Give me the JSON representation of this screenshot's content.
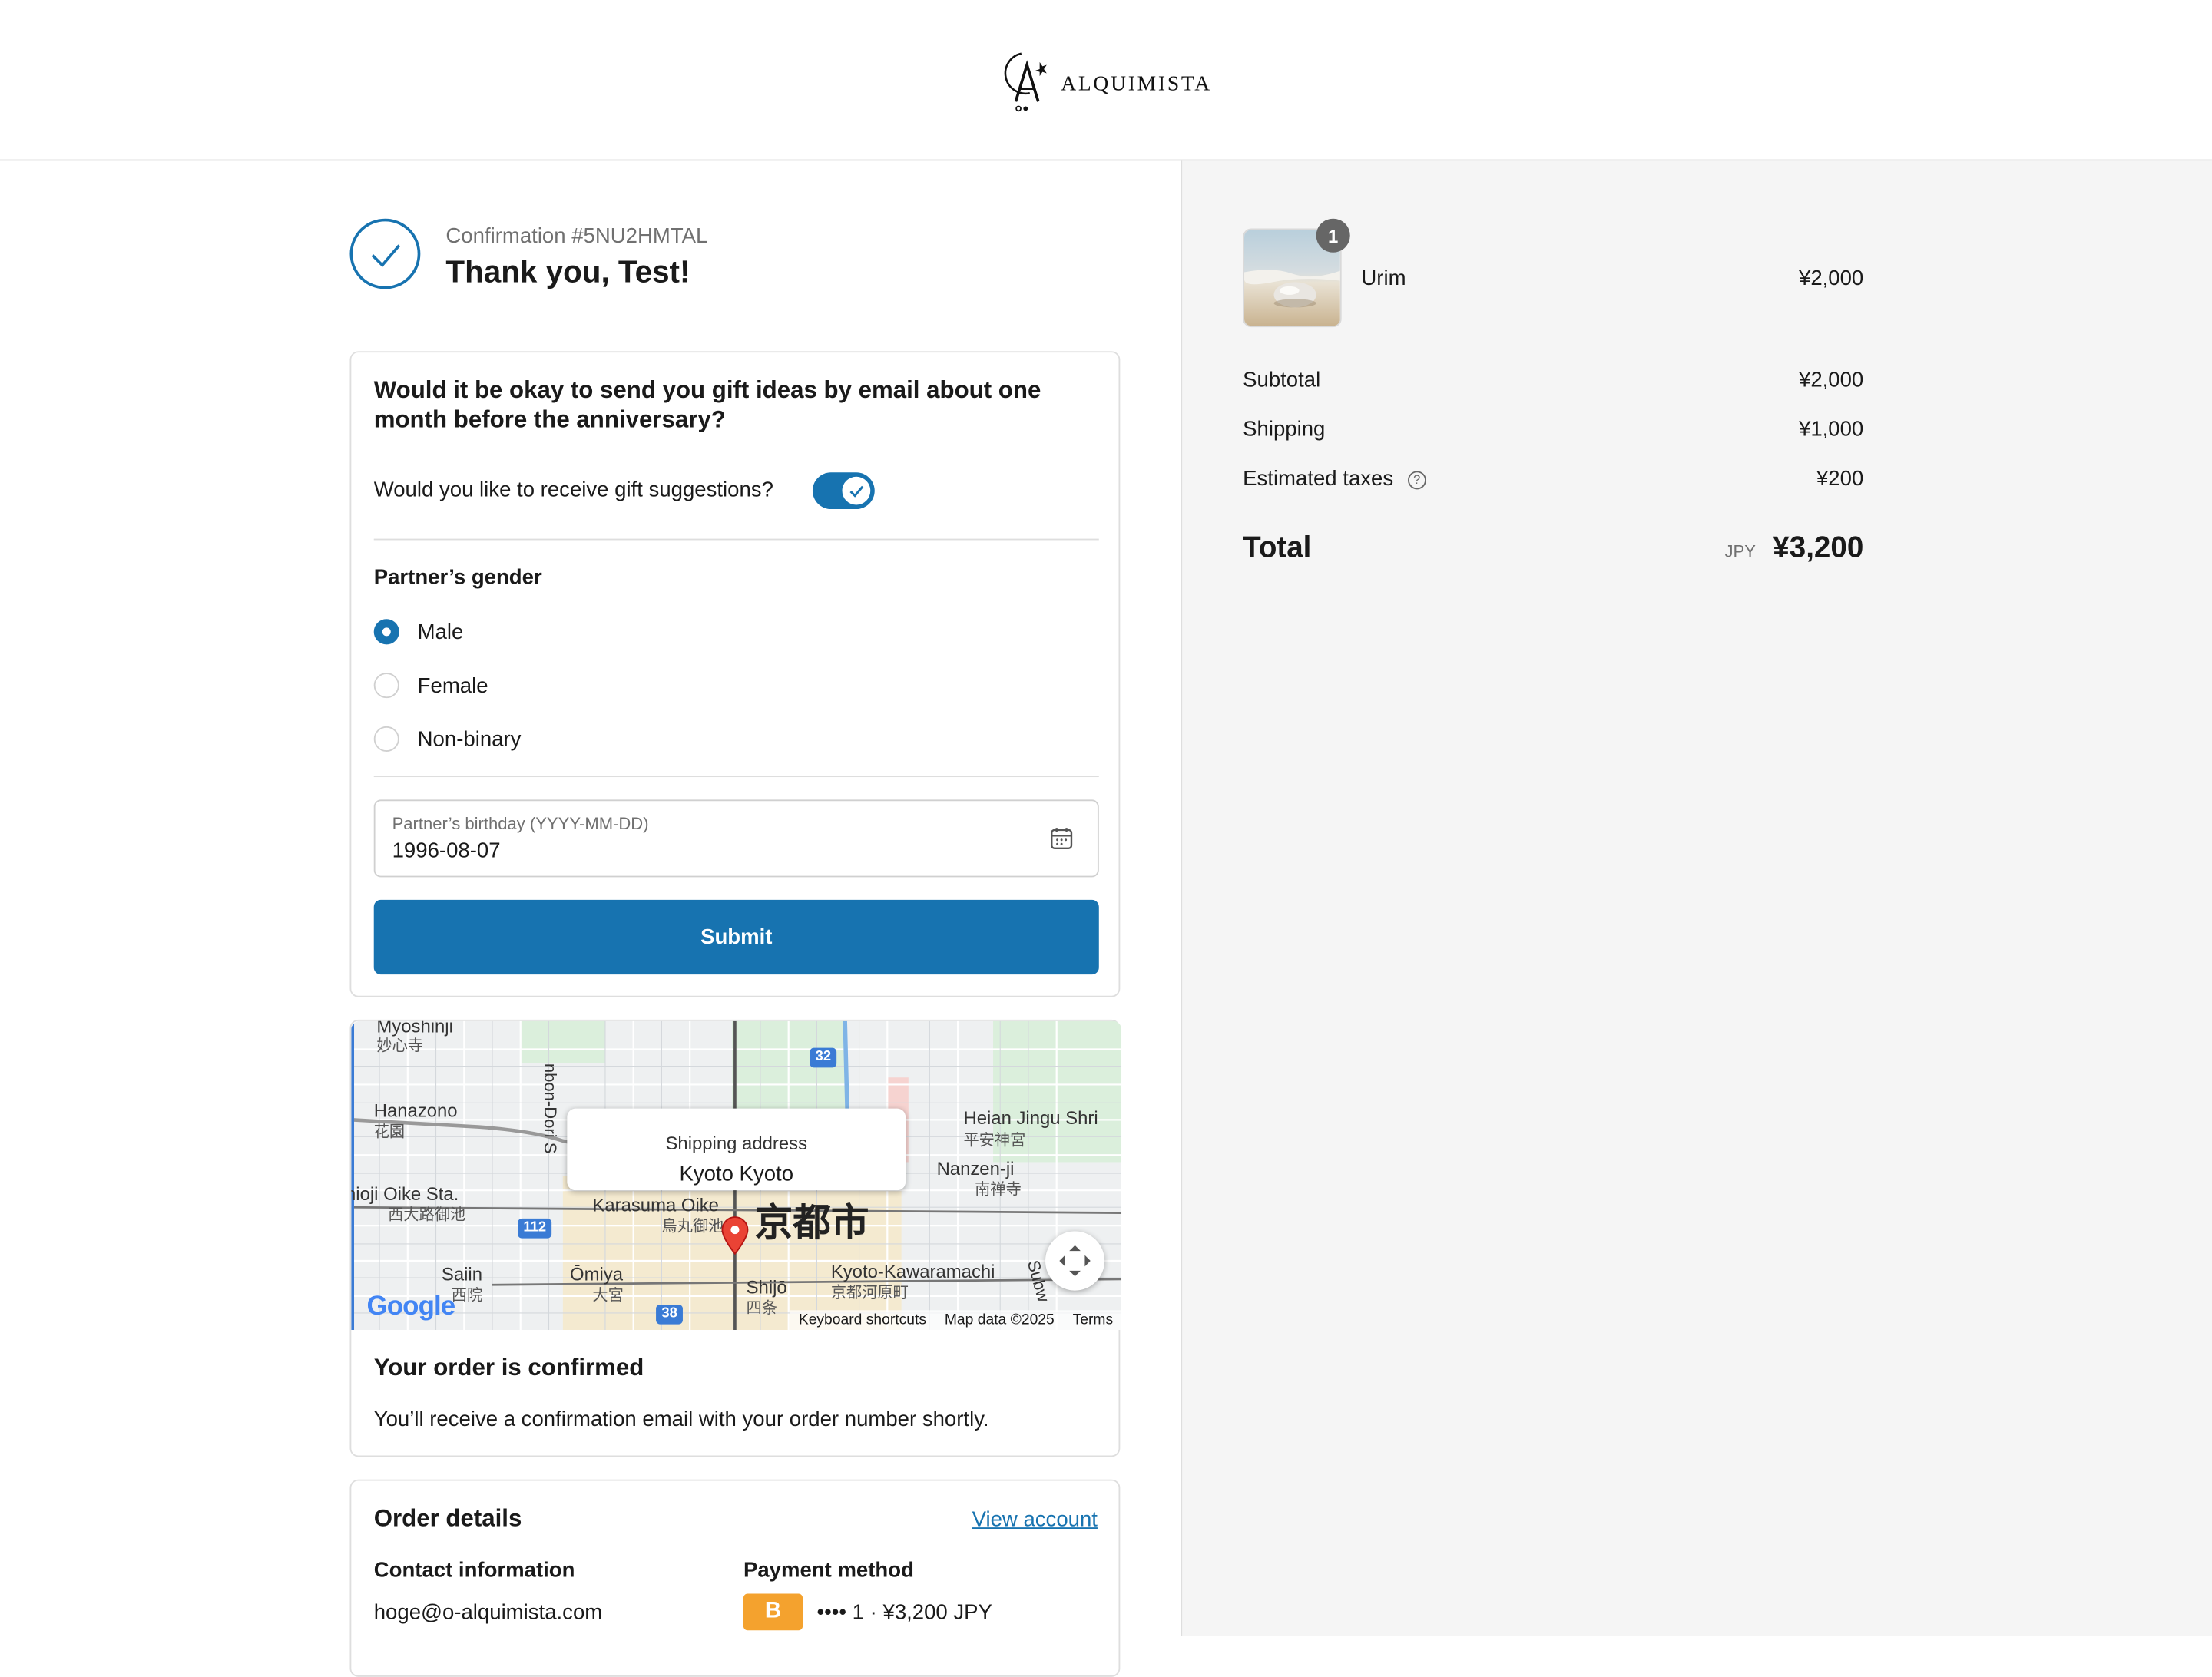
{
  "brand": {
    "name": "ALQUIMISTA"
  },
  "confirmation": {
    "label": "Confirmation #5NU2HMTAL",
    "thanks": "Thank you, Test!"
  },
  "survey": {
    "question": "Would it be okay to send you gift ideas by email about one month before the anniversary?",
    "toggle_label": "Would you like to receive gift suggestions?",
    "toggle_on": true,
    "gender_title": "Partner’s gender",
    "gender_options": [
      {
        "label": "Male",
        "selected": true
      },
      {
        "label": "Female",
        "selected": false
      },
      {
        "label": "Non-binary",
        "selected": false
      }
    ],
    "birthday_label": "Partner’s birthday (YYYY-MM-DD)",
    "birthday_value": "1996-08-07",
    "submit_label": "Submit"
  },
  "map": {
    "popup_label": "Shipping address",
    "popup_value": "Kyoto Kyoto",
    "labels": {
      "myoshinji": "Myoshinji",
      "myoshinji_jp": "妙心寺",
      "hanazono": "Hanazono",
      "hanazono_jp": "花園",
      "oike": "nioji Oike Sta.",
      "oike_jp": "西大路御池",
      "karasuma": "Karasuma Oike",
      "karasuma_jp": "烏丸御池",
      "kyoto_city": "京都市",
      "heian": "Heian Jingu Shri",
      "heian_jp": "平安神宮",
      "nanzenji": "Nanzen-ji",
      "nanzenji_jp": "南禅寺",
      "saiin": "Saiin",
      "saiin_jp": "西院",
      "omiya": "Ōmiya",
      "omiya_jp": "大宮",
      "shijo": "Shijō",
      "shijo_jp": "四条",
      "kawaramachi": "Kyoto-Kawaramachi",
      "kawaramachi_jp": "京都河原町",
      "senbon": "nbon-Dori S",
      "subway": "Subw"
    },
    "road_badges": [
      "32",
      "112",
      "38"
    ],
    "attribution": {
      "shortcuts": "Keyboard shortcuts",
      "data": "Map data ©2025",
      "terms": "Terms"
    },
    "google": "Google"
  },
  "order_status": {
    "title": "Your order is confirmed",
    "text": "You’ll receive a confirmation email with your order number shortly."
  },
  "order_details": {
    "title": "Order details",
    "view_account": "View account",
    "contact_title": "Contact information",
    "contact_value": "hoge@o-alquimista.com",
    "payment_title": "Payment method",
    "payment_badge": "B",
    "payment_value": "•••• 1 · ¥3,200 JPY"
  },
  "summary": {
    "item": {
      "name": "Urim",
      "price": "¥2,000",
      "quantity": "1"
    },
    "subtotal_label": "Subtotal",
    "subtotal_value": "¥2,000",
    "shipping_label": "Shipping",
    "shipping_value": "¥1,000",
    "taxes_label": "Estimated taxes",
    "taxes_value": "¥200",
    "total_label": "Total",
    "total_currency": "JPY",
    "total_value": "¥3,200"
  },
  "colors": {
    "accent": "#1773b0",
    "panel_bg": "#f5f5f5",
    "border": "#dedede",
    "payment_badge": "#f4a22e"
  }
}
